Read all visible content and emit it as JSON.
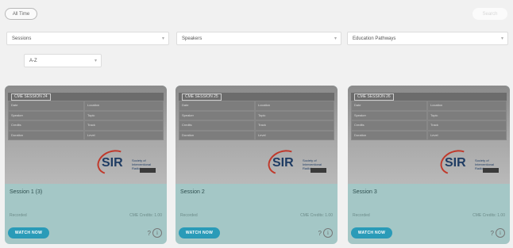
{
  "header": {
    "filter_button": "All Time",
    "right_button": "Search"
  },
  "filters": {
    "sessions": "Sessions",
    "speakers": "Speakers",
    "education_pathways": "Education Pathways",
    "sort": "A-Z",
    "chevron": "▾"
  },
  "cards": [
    {
      "thumb_header": "CME SESSION 24",
      "grid": [
        "Date",
        "Location",
        "Speaker",
        "Topic",
        "Credits",
        "Track",
        "Duration",
        "Level"
      ],
      "logo_text": "SIR",
      "logo_sub": "Society of Interventional Radiology",
      "title": "Session 1 (3)",
      "meta_left": "Recorded",
      "meta_right": "CME Credits: 1.00",
      "watch_label": "WATCH NOW",
      "icon_q": "?",
      "icon_i": "i"
    },
    {
      "thumb_header": "CME SESSION 25",
      "grid": [
        "Date",
        "Location",
        "Speaker",
        "Topic",
        "Credits",
        "Track",
        "Duration",
        "Level"
      ],
      "logo_text": "SIR",
      "logo_sub": "Society of Interventional Radiology",
      "title": "Session 2",
      "meta_left": "Recorded",
      "meta_right": "CME Credits: 1.00",
      "watch_label": "WATCH NOW",
      "icon_q": "?",
      "icon_i": "i"
    },
    {
      "thumb_header": "CME SESSION 26",
      "grid": [
        "Date",
        "Location",
        "Speaker",
        "Topic",
        "Credits",
        "Track",
        "Duration",
        "Level"
      ],
      "logo_text": "SIR",
      "logo_sub": "Society of Interventional Radiology",
      "title": "Session 3",
      "meta_left": "Recorded",
      "meta_right": "CME Credits: 1.00",
      "watch_label": "WATCH NOW",
      "icon_q": "?",
      "icon_i": "i"
    }
  ]
}
